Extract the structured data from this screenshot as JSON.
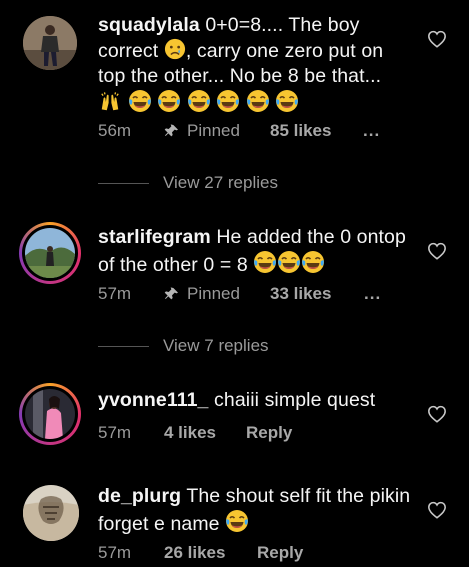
{
  "comments": [
    {
      "user": "squadylala",
      "text_parts": [
        "0+0=8.... The boy correct",
        ", carry one zero put on top the other... No be 8 be that..."
      ],
      "time": "56m",
      "pinned": "Pinned",
      "likes": "85 likes",
      "more": "...",
      "view_replies": "View 27 replies"
    },
    {
      "user": "starlifegram",
      "text": "He added the 0 ontop of the other 0 = 8",
      "time": "57m",
      "pinned": "Pinned",
      "likes": "33 likes",
      "more": "...",
      "view_replies": "View 7 replies"
    },
    {
      "user": "yvonne111_",
      "text": "chaiii simple quest",
      "time": "57m",
      "likes": "4 likes",
      "reply": "Reply"
    },
    {
      "user": "de_plurg",
      "text": "The shout self fit the pikin forget e name",
      "time": "57m",
      "likes": "26 likes",
      "reply": "Reply"
    }
  ],
  "icons": {
    "like": "heart-outline-icon",
    "pin": "pin-icon",
    "emoji_laugh": "tears-of-joy-emoji",
    "emoji_sad": "crying-face-emoji",
    "emoji_hands": "raising-hands-emoji"
  },
  "colors": {
    "background": "#000000",
    "text": "#f5f5f5",
    "muted": "#9a9a9a",
    "story_ring": "#e1306c"
  }
}
